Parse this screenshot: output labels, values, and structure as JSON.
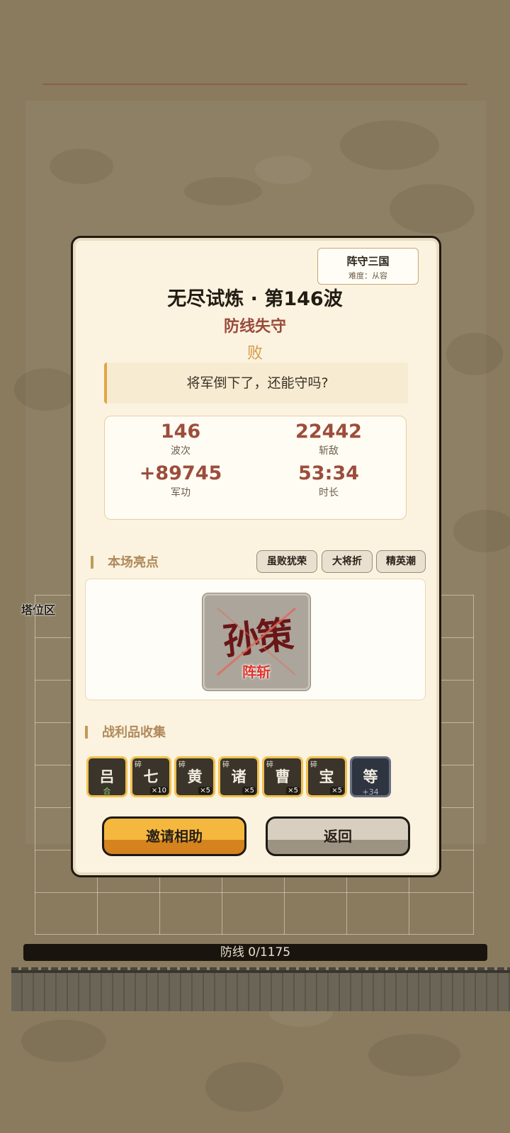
{
  "game": {
    "name": "阵守三国",
    "difficulty": "难度：从容"
  },
  "board": {
    "tower_zone_label": "塔位区",
    "defense_bar_label": "防线 0/1175",
    "defense_current": 0,
    "defense_max": 1175
  },
  "result_dialog": {
    "title": "无尽试炼 · 第146波",
    "subtitle": "防线失守",
    "result": "败",
    "quote": "将军倒下了，还能守吗?",
    "stats": [
      {
        "value": "146",
        "label": "波次"
      },
      {
        "value": "22442",
        "label": "斩敌"
      },
      {
        "value": "+89745",
        "label": "军功"
      },
      {
        "value": "53:34",
        "label": "时长"
      }
    ],
    "highlights_title": "本场亮点",
    "tags": [
      "虽败犹荣",
      "大将折",
      "精英潮"
    ],
    "highlight_card": {
      "name": "孙策",
      "caption": "阵斩"
    },
    "loot_title": "战利品收集",
    "loot": [
      {
        "char": "吕",
        "frag": "",
        "qty": "",
        "sub": "合"
      },
      {
        "char": "七",
        "frag": "碎",
        "qty": "×10",
        "sub": ""
      },
      {
        "char": "黄",
        "frag": "碎",
        "qty": "×5",
        "sub": ""
      },
      {
        "char": "诸",
        "frag": "碎",
        "qty": "×5",
        "sub": ""
      },
      {
        "char": "曹",
        "frag": "碎",
        "qty": "×5",
        "sub": ""
      },
      {
        "char": "宝",
        "frag": "碎",
        "qty": "×5",
        "sub": ""
      },
      {
        "char": "等",
        "frag": "",
        "qty": "",
        "sub": "+34"
      }
    ],
    "buttons": {
      "invite": "邀请相助",
      "back": "返回"
    }
  },
  "colors": {
    "accent_gold": "#f1c04e",
    "stat_red": "#9c4d3b",
    "panel_cream": "#fbf3df"
  }
}
